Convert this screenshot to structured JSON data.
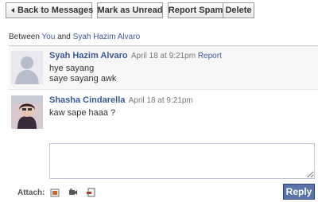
{
  "toolbar": {
    "back_label": "Back to Messages",
    "unread_label": "Mark as Unread",
    "spam_label": "Report Spam",
    "delete_label": "Delete"
  },
  "thread": {
    "between_prefix": "Between",
    "you": "You",
    "and": "and",
    "participant": "Syah Hazim Alvaro"
  },
  "messages": [
    {
      "author": "Syah Hazim Alvaro",
      "time": "April 18 at 9:21pm",
      "report": "Report",
      "lines": [
        "hye sayang",
        "saye sayang awk"
      ]
    },
    {
      "author": "Shasha Cindarella",
      "time": "April 18 at 9:21pm",
      "lines": [
        "kaw sape haaa ?"
      ]
    }
  ],
  "composer": {
    "value": "",
    "attach_label": "Attach:",
    "attach_icons": [
      "photo-icon",
      "video-icon",
      "link-icon"
    ],
    "reply_label": "Reply"
  },
  "colors": {
    "link": "#3b5998",
    "reply_button": "#5b74a8",
    "header_bg": "#f7f7f7"
  }
}
